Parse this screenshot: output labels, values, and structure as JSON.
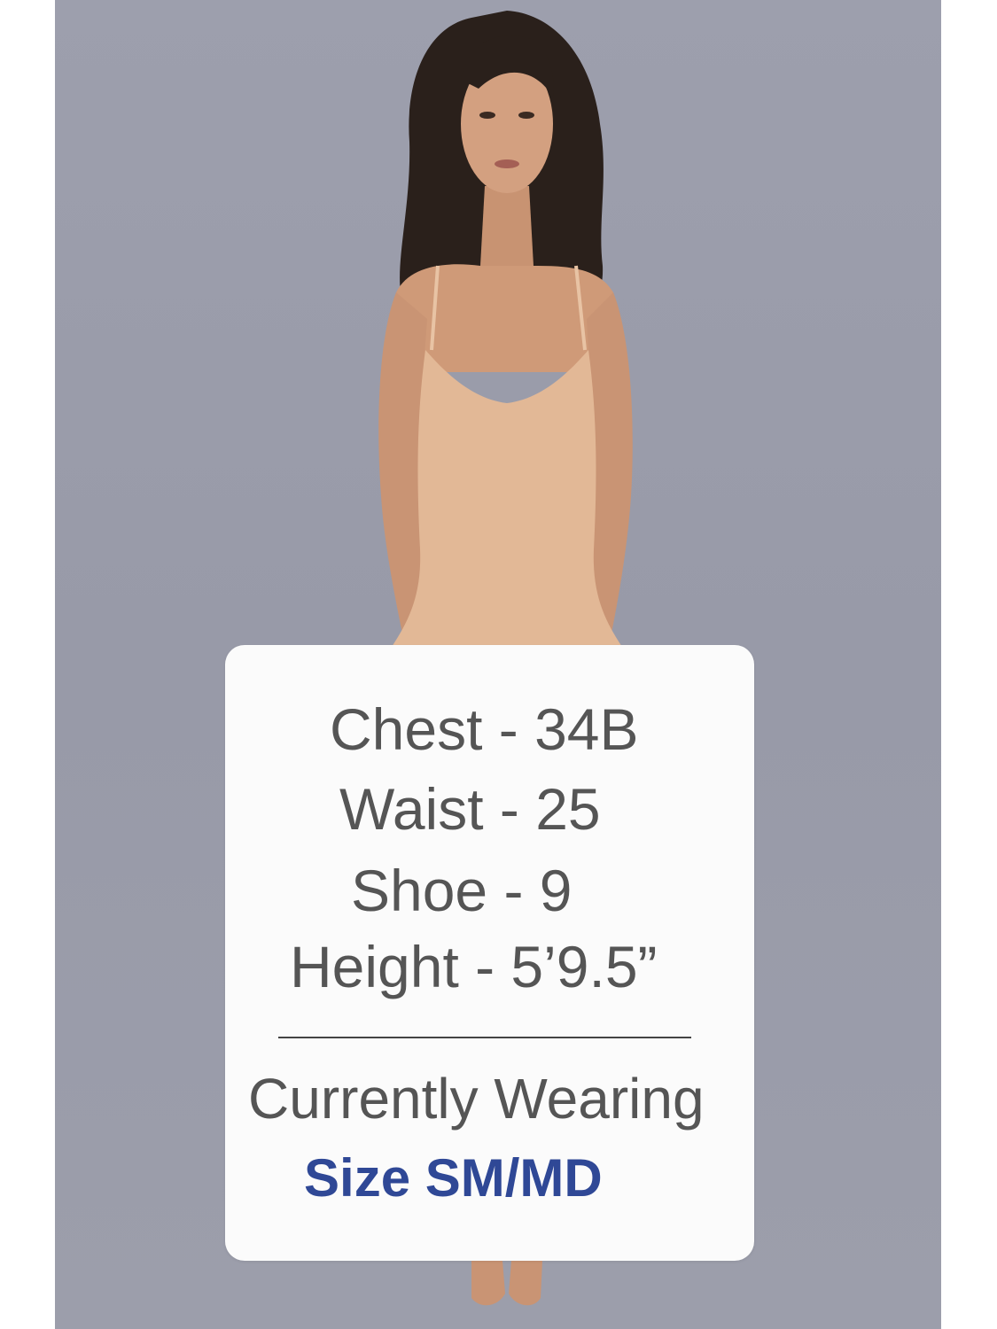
{
  "card": {
    "chest": "Chest - 34B",
    "waist": "Waist - 25",
    "shoe": "Shoe - 9",
    "height": "Height - 5’9.5”",
    "currently_wearing": "Currently Wearing",
    "size": "Size SM/MD"
  },
  "colors": {
    "background": "#9c9eab",
    "card": "#fbfbfb",
    "stat_text": "#555555",
    "size_text": "#2f4896"
  }
}
